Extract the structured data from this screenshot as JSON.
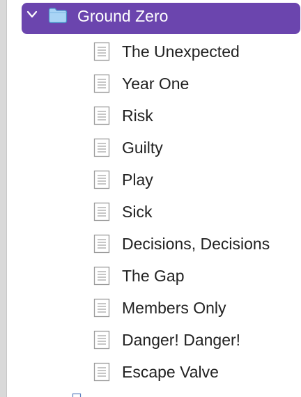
{
  "binder": {
    "folder": {
      "title": "Ground Zero",
      "expanded": true,
      "icon": "folder-icon",
      "selected_color": "#6b45ae"
    },
    "documents": [
      {
        "title": "The Unexpected",
        "icon": "document-icon"
      },
      {
        "title": "Year One",
        "icon": "document-icon"
      },
      {
        "title": "Risk",
        "icon": "document-icon"
      },
      {
        "title": "Guilty",
        "icon": "document-icon"
      },
      {
        "title": "Play",
        "icon": "document-icon"
      },
      {
        "title": "Sick",
        "icon": "document-icon"
      },
      {
        "title": "Decisions, Decisions",
        "icon": "document-icon"
      },
      {
        "title": "The Gap",
        "icon": "document-icon"
      },
      {
        "title": "Members Only",
        "icon": "document-icon"
      },
      {
        "title": "Danger! Danger!",
        "icon": "document-icon"
      },
      {
        "title": "Escape Valve",
        "icon": "document-icon"
      }
    ]
  }
}
